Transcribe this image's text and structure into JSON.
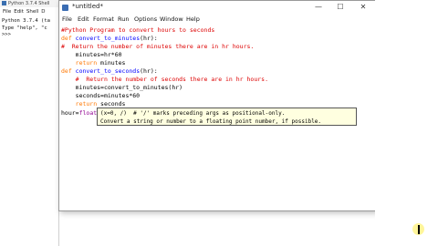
{
  "shell": {
    "title": "Python 3.7.4 Shell",
    "menu": [
      "File",
      "Edit",
      "Shell",
      "D"
    ],
    "lines": [
      "Python 3.7.4 (ta",
      "Type \"help\", \"c",
      ">>>"
    ]
  },
  "editor": {
    "title": "*untitled*",
    "menu": [
      "File",
      "Edit",
      "Format",
      "Run",
      "Options",
      "Window",
      "Help"
    ],
    "controls": {
      "minimize": "—",
      "maximize": "☐",
      "close": "✕"
    },
    "code": [
      {
        "indent": "",
        "text": "#Python Program to convert hours to seconds"
      },
      {
        "kw": "def",
        "name": "convert_to_minutes",
        "rest": "(hr):"
      },
      {
        "indent": "",
        "text": "#  Return the number of minutes there are in hr hours."
      },
      {
        "indent": "    ",
        "text": "minutes=hr*60"
      },
      {
        "indent": "    ",
        "kw": "return",
        "rest": " minutes"
      },
      {
        "kw": "def",
        "name": "convert_to_seconds",
        "rest": "(hr):"
      },
      {
        "indent": "    ",
        "text": "#  Return the number of seconds there are in hr hours."
      },
      {
        "indent": "    ",
        "text": "minutes=convert_to_minutes(hr)"
      },
      {
        "indent": "    ",
        "text": "seconds=minutes*60"
      },
      {
        "indent": "    ",
        "kw": "return",
        "rest": " seconds"
      },
      {
        "prefix": "hour=",
        "builtin": "float",
        "rest": "("
      }
    ],
    "calltip": [
      "(x=0, /)  # '/' marks preceding args as positional-only.",
      "Convert a string or number to a floating point number, if possible."
    ]
  }
}
